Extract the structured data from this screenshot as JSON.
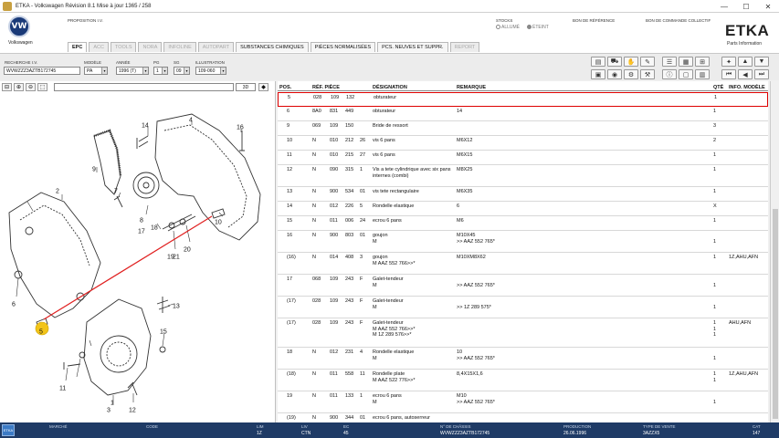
{
  "window": {
    "title": "ETKA - Volkswagen Révision 8.1 Mise à jour 1365 / 258",
    "minimize": "—",
    "maximize": "☐",
    "close": "✕"
  },
  "header": {
    "brand": "Volkswagen",
    "brand_mark": "VW",
    "proposition": "PROPOSITION I.V.",
    "stocks_label": "STOCKS",
    "stock_on": "ALLUMÉ",
    "stock_off": "ÉTEINT",
    "bon_reference": "BON DE RÉFÉRENCE",
    "bon_commande": "BON DE COMMANDE COLLECTIF",
    "etka_title": "ETKA",
    "etka_subtitle": "Parts Information"
  },
  "tabs": [
    {
      "label": "EPC",
      "state": "active"
    },
    {
      "label": "ACC",
      "state": "disabled"
    },
    {
      "label": "TOOLS",
      "state": "disabled"
    },
    {
      "label": "NORA",
      "state": "disabled"
    },
    {
      "label": "INFOLINE",
      "state": "disabled"
    },
    {
      "label": "AUTOPART",
      "state": "disabled"
    },
    {
      "label": "SUBSTANCES CHIMIQUES",
      "state": "on"
    },
    {
      "label": "PIÈCES NORMALISÉES",
      "state": "on"
    },
    {
      "label": "PCS. NEUVES ET SUPPR.",
      "state": "on"
    },
    {
      "label": "REPORT",
      "state": "disabled"
    }
  ],
  "params": {
    "recherche_label": "RECHERCHE I.V.",
    "recherche_value": "WVWZZZ3AZTB172745",
    "modele_label": "MODÈLE",
    "modele_value": "PA",
    "annee_label": "ANNÉE",
    "annee_value": "1996 (T)",
    "pg_label": "PG",
    "pg_value": "1",
    "sg_label": "SG",
    "sg_value": "09",
    "illus_label": "ILLUSTRATION",
    "illus_value": "109-060"
  },
  "left_toolbar": {
    "zoom_value": "3D"
  },
  "drawing": {
    "callouts": [
      "1",
      "2",
      "3",
      "4",
      "5",
      "6",
      "7",
      "8",
      "9",
      "10",
      "11",
      "12",
      "13",
      "14",
      "15",
      "16",
      "17",
      "18",
      "19",
      "20",
      "21"
    ],
    "highlight": "5"
  },
  "table": {
    "headers": {
      "pos": "POS.",
      "ref": "RÉF. PIÈCE",
      "des": "DÉSIGNATION",
      "rem": "REMARQUE",
      "qte": "QTÉ",
      "info": "INFO. MODÈLE"
    },
    "rows": [
      {
        "pos": "5",
        "r1": "028",
        "r2": "109",
        "r3": "132",
        "r4": "",
        "des": "obturateur",
        "rem": "",
        "qte": "1",
        "info": "",
        "h": 16,
        "sel": true
      },
      {
        "pos": "6",
        "r1": "8A0",
        "r2": "831",
        "r3": "449",
        "r4": "",
        "des": "obturateur",
        "rem": "14",
        "qte": "1",
        "info": "",
        "h": 16
      },
      {
        "pos": "9",
        "r1": "069",
        "r2": "109",
        "r3": "150",
        "r4": "",
        "des": "Bride de ressort",
        "rem": "",
        "qte": "3",
        "info": "",
        "h": 16
      },
      {
        "pos": "10",
        "r1": "N",
        "r2": "010",
        "r3": "212",
        "r4": "26",
        "des": "vis 6 pans",
        "rem": "M6X12",
        "qte": "2",
        "info": "",
        "h": 16
      },
      {
        "pos": "11",
        "r1": "N",
        "r2": "010",
        "r3": "215",
        "r4": "27",
        "des": "vis 6 pans",
        "rem": "M6X15",
        "qte": "1",
        "info": "",
        "h": 16
      },
      {
        "pos": "12",
        "r1": "N",
        "r2": "090",
        "r3": "315",
        "r4": "1",
        "des": "Vis a tete cylindrique avec six pans internes (combi)",
        "rem": "M8X25",
        "qte": "1",
        "info": "",
        "h": 24
      },
      {
        "pos": "13",
        "r1": "N",
        "r2": "900",
        "r3": "534",
        "r4": "01",
        "des": "vis tete rectangulaire",
        "rem": "M6X35",
        "qte": "1",
        "info": "",
        "h": 16
      },
      {
        "pos": "14",
        "r1": "N",
        "r2": "012",
        "r3": "226",
        "r4": "5",
        "des": "Rondelle elastique",
        "rem": "6",
        "qte": "X",
        "info": "",
        "h": 16
      },
      {
        "pos": "15",
        "r1": "N",
        "r2": "011",
        "r3": "006",
        "r4": "24",
        "des": "ecrou 6 pans",
        "rem": "M6",
        "qte": "1",
        "info": "",
        "h": 16
      },
      {
        "pos": "16",
        "r1": "N",
        "r2": "900",
        "r3": "803",
        "r4": "01",
        "des": "goujon\nM",
        "rem": "M10X45\n>> AAZ  552 765*",
        "qte": "\n1",
        "info": "",
        "h": 24
      },
      {
        "pos": "(16)",
        "r1": "N",
        "r2": "014",
        "r3": "408",
        "r4": "3",
        "des": "goujon\nM AAZ  552 766>>*",
        "rem": "M10XM8X62",
        "qte": "1",
        "info": "1Z,AHU,AFN",
        "h": 24
      },
      {
        "pos": "17",
        "r1": "068",
        "r2": "109",
        "r3": "243",
        "r4": "F",
        "des": "Galet-tendeur\nM",
        "rem": "\n>> AAZ  552 765*",
        "qte": "\n1",
        "info": "",
        "h": 24
      },
      {
        "pos": "(17)",
        "r1": "028",
        "r2": "109",
        "r3": "243",
        "r4": "F",
        "des": "Galet-tendeur\nM",
        "rem": "\n>> 1Z  289 575*",
        "qte": "\n1",
        "info": "",
        "h": 24
      },
      {
        "pos": "(17)",
        "r1": "028",
        "r2": "109",
        "r3": "243",
        "r4": "F",
        "des": "Galet-tendeur\nM AAZ  552 766>>*\nM  1Z  289 576>>*",
        "rem": "",
        "qte": "1\n1\n1",
        "info": "AHU,AFN",
        "h": 32
      },
      {
        "pos": "18",
        "r1": "N",
        "r2": "012",
        "r3": "231",
        "r4": "4",
        "des": "Rondelle elastique\nM",
        "rem": "10\n>> AAZ  552 765*",
        "qte": "\n1",
        "info": "",
        "h": 24
      },
      {
        "pos": "(18)",
        "r1": "N",
        "r2": "011",
        "r3": "558",
        "r4": "11",
        "des": "Rondelle plate\nM AAZ  522 776>>*",
        "rem": "8,4X15X1,6",
        "qte": "1\n1",
        "info": "1Z,AHU,AFN",
        "h": 24
      },
      {
        "pos": "19",
        "r1": "N",
        "r2": "011",
        "r3": "133",
        "r4": "1",
        "des": "ecrou 6 pans\nM",
        "rem": "M10\n>> AAZ  552 765*",
        "qte": "\n1",
        "info": "",
        "h": 24
      },
      {
        "pos": "(19)",
        "r1": "N",
        "r2": "900",
        "r3": "344",
        "r4": "01",
        "des": "ecrou 6 pans, autoserreur",
        "rem": "",
        "qte": "",
        "info": "",
        "h": 16
      }
    ]
  },
  "statusbar": {
    "logo": "ETKA",
    "marche_label": "MARCHÉ",
    "marche_value": "",
    "code_label": "CODE",
    "code_value": "",
    "lim_label": "LIM",
    "lim_value": "1Z",
    "liv_label": "LIV",
    "liv_value": "CTN",
    "ec_label": "EC",
    "ec_value": "45",
    "chassis_label": "N° DE CHÂSSIS",
    "chassis_value": "WVWZZZ3AZTB172745",
    "production_label": "PRODUCTION",
    "production_value": "26.06.1996",
    "type_vente_label": "TYPE DE VENTE",
    "type_vente_value": "3AZZX5",
    "cat_label": "CAT",
    "cat_value": "147"
  }
}
